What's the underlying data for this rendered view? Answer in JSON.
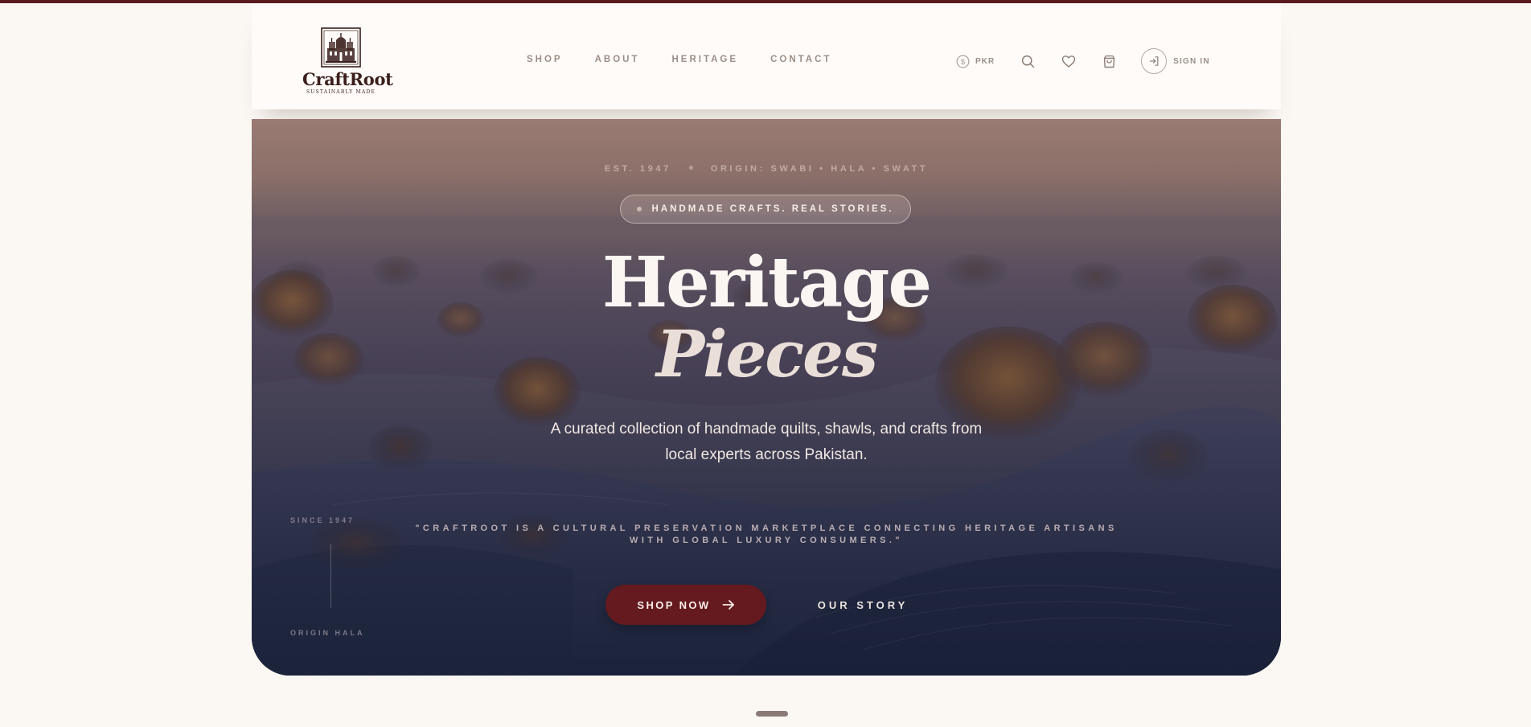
{
  "brand": {
    "name": "CraftRoot",
    "tagline": "SUSTAINABLY MADE",
    "logo_icon": "palace-icon"
  },
  "nav": {
    "items": [
      {
        "label": "SHOP"
      },
      {
        "label": "ABOUT"
      },
      {
        "label": "HERITAGE"
      },
      {
        "label": "CONTACT"
      }
    ]
  },
  "tools": {
    "currency": "PKR",
    "currency_icon": "currency-icon",
    "search_icon": "search-icon",
    "wishlist_icon": "heart-icon",
    "cart_icon": "shopping-bag-icon",
    "signin_icon": "login-arrow-icon",
    "signin_label": "SIGN IN"
  },
  "hero": {
    "est": "EST. 1947",
    "origin": "ORIGIN: SWABI • HALA • SWATT",
    "badge": "HANDMADE CRAFTS. REAL STORIES.",
    "title_line1": "Heritage",
    "title_line2": "Pieces",
    "subtitle": "A curated collection of handmade quilts, shawls, and crafts from local experts across Pakistan.",
    "quote": "\"CRAFTROOT IS A CULTURAL PRESERVATION MARKETPLACE CONNECTING HERITAGE ARTISANS WITH GLOBAL LUXURY CONSUMERS.\"",
    "side_since": "SINCE 1947",
    "side_origin": "ORIGIN HALA",
    "cta_primary": "SHOP NOW",
    "cta_secondary": "OUR STORY"
  },
  "colors": {
    "accent": "#641a1e",
    "page_bg": "#fbf7f3",
    "nav_text": "#9c8e88"
  }
}
